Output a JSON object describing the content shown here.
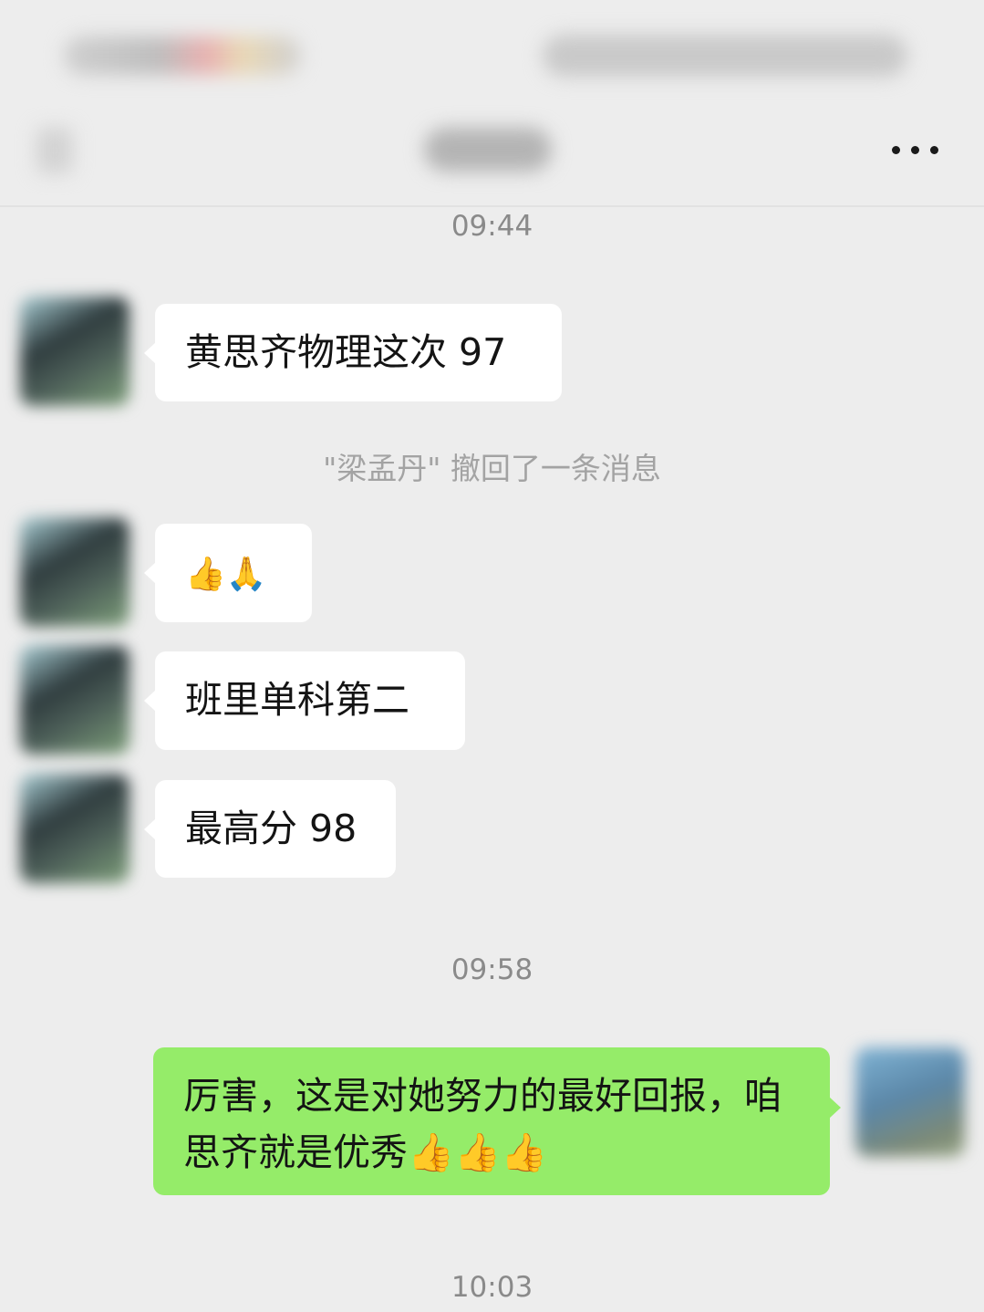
{
  "header": {
    "title": ""
  },
  "timestamps": [
    "09:44",
    "09:58",
    "10:03"
  ],
  "system_note": "\"梁孟丹\" 撤回了一条消息",
  "messages": [
    {
      "text": "黄思齐物理这次 97"
    },
    {
      "text": "👍🙏",
      "icons": [
        "thumbs-up-icon",
        "praying-hands-icon"
      ]
    },
    {
      "text": "班里单科第二"
    },
    {
      "text": "最高分 98"
    },
    {
      "text": "厉害，这是对她努力的最好回报，咱思齐就是优秀👍👍👍"
    }
  ],
  "colors": {
    "background": "#ededed",
    "incoming_bubble": "#ffffff",
    "outgoing_bubble": "#95ec69",
    "timestamp": "#8a8a8a"
  },
  "icons": {
    "more": "more-dots-icon",
    "back": "back-arrow-icon"
  }
}
